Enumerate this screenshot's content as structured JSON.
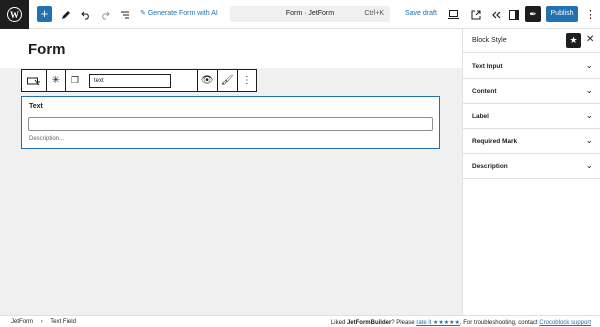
{
  "topbar": {
    "add_label": "+",
    "generate_ai": "Generate Form with AI",
    "document_title": "Form · JetForm",
    "shortcut": "Ctrl+K",
    "save_draft": "Save draft",
    "publish": "Publish"
  },
  "canvas": {
    "page_title": "Form",
    "toolbar_input": "text",
    "field": {
      "label": "Text",
      "description": "Description..."
    }
  },
  "sidebar": {
    "title": "Block Style",
    "panels": [
      "Text Input",
      "Content",
      "Label",
      "Required Mark",
      "Description"
    ]
  },
  "footer": {
    "breadcrumb_root": "JetForm",
    "breadcrumb_sep": "›",
    "breadcrumb_item": "Text Field",
    "msg_prefix": "Liked ",
    "msg_brand": "JetFormBuilder",
    "msg_mid": "? Please ",
    "msg_rate": "rate it ★★★★★",
    "msg_after": ". For troubleshooting, contact ",
    "msg_support": "Crocoblock support"
  },
  "colors": {
    "accent": "#2271b1",
    "dark": "#1e1e1e"
  }
}
